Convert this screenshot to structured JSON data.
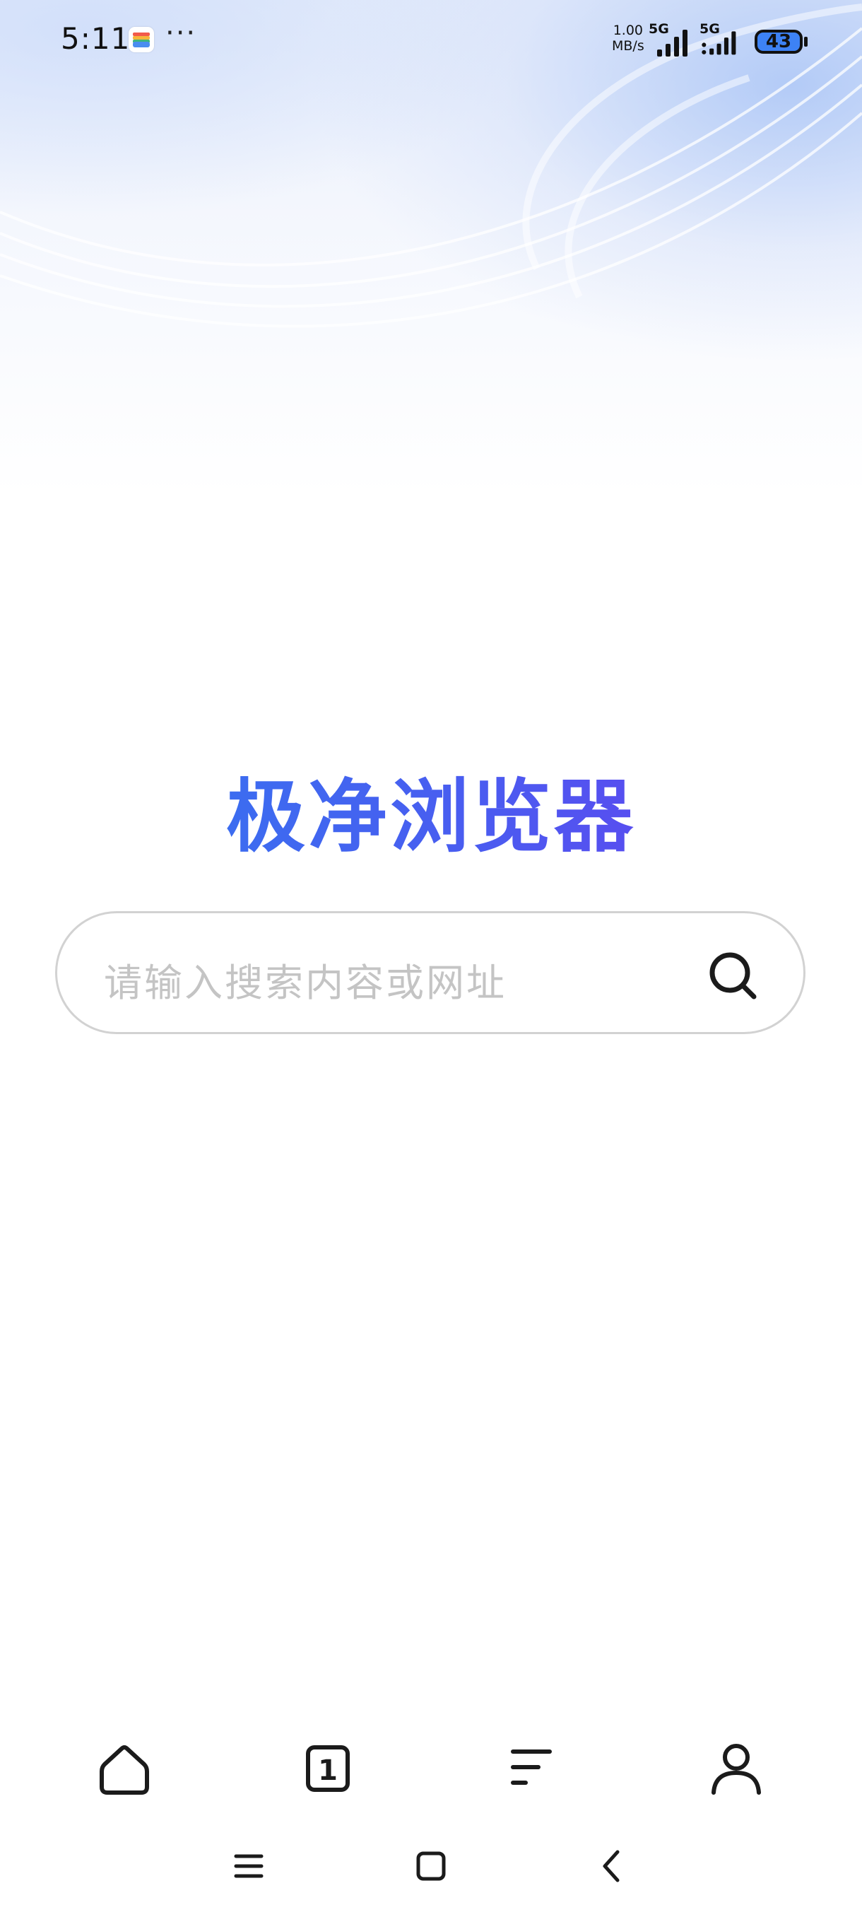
{
  "status_bar": {
    "time": "5:11",
    "more": "···",
    "net_speed_value": "1.00",
    "net_speed_unit": "MB/s",
    "sim1_label": "5G",
    "sim2_label": "5G",
    "battery": "43"
  },
  "main": {
    "app_title": "极净浏览器",
    "search_placeholder": "请输入搜索内容或网址"
  },
  "bottom_nav": {
    "tab_count": "1",
    "items": [
      "home-icon",
      "tabs-icon",
      "menu-icon",
      "profile-icon"
    ]
  },
  "system_nav": {
    "items": [
      "recents-icon",
      "home-square-icon",
      "back-icon"
    ]
  },
  "colors": {
    "title_gradient_start": "#2f7bf0",
    "title_gradient_end": "#6a3cf0",
    "placeholder": "#c4c4c4"
  }
}
